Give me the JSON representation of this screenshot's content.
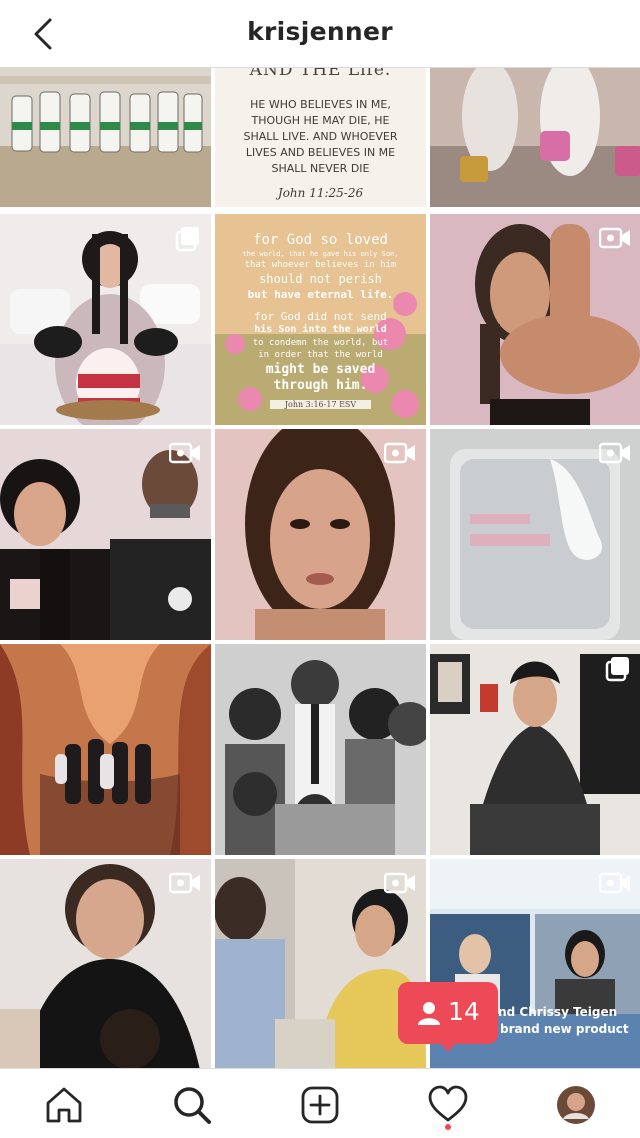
{
  "header": {
    "title": "krisjenner",
    "back_icon": "chevron-left-icon"
  },
  "posts": [
    {
      "id": 1,
      "type": "photo",
      "overlay": "none",
      "colors": [
        "#ddd6cc",
        "#6f6a63"
      ]
    },
    {
      "id": 2,
      "type": "text-graphic",
      "overlay": "none",
      "lines": [
        "AND THE Life.",
        "HE WHO BELIEVES IN ME,",
        "THOUGH HE MAY DIE, HE",
        "SHALL LIVE. AND WHOEVER",
        "LIVES AND BELIEVES IN ME",
        "SHALL NEVER DIE",
        "John 11:25-26"
      ]
    },
    {
      "id": 3,
      "type": "photo",
      "overlay": "none",
      "colors": [
        "#c9b7ae",
        "#7e6e69"
      ]
    },
    {
      "id": 4,
      "type": "photo",
      "overlay": "carousel-icon",
      "colors": [
        "#f0ecec",
        "#cbb8bd"
      ]
    },
    {
      "id": 5,
      "type": "text-graphic",
      "overlay": "none",
      "lines": [
        "for God so loved",
        "the world, that he gave his only Son,",
        "that whoever believes in him",
        "should not perish",
        "but have eternal life.",
        "for God did not send",
        "his Son into the world",
        "to condemn the world, but",
        "in order that the world",
        "might be saved",
        "through him.",
        "John 3:16-17 ESV"
      ]
    },
    {
      "id": 6,
      "type": "video",
      "overlay": "video-icon",
      "colors": [
        "#d9b8c2",
        "#8d6a73"
      ]
    },
    {
      "id": 7,
      "type": "video",
      "overlay": "video-icon",
      "colors": [
        "#e6d8d8",
        "#2a2424"
      ]
    },
    {
      "id": 8,
      "type": "video",
      "overlay": "video-icon",
      "colors": [
        "#e3c4c0",
        "#6e4838"
      ]
    },
    {
      "id": 9,
      "type": "video",
      "overlay": "video-icon",
      "colors": [
        "#cfd1d1",
        "#9ea3a5"
      ]
    },
    {
      "id": 10,
      "type": "photo",
      "overlay": "none",
      "colors": [
        "#c4774a",
        "#5d2c21"
      ]
    },
    {
      "id": 11,
      "type": "photo",
      "overlay": "none",
      "colors": [
        "#cfcfcf",
        "#3b3b3b"
      ]
    },
    {
      "id": 12,
      "type": "photo",
      "overlay": "carousel-icon",
      "colors": [
        "#e9e6e2",
        "#2e2e2e"
      ]
    },
    {
      "id": 13,
      "type": "video",
      "overlay": "video-icon",
      "colors": [
        "#e7e2df",
        "#1c1c1c"
      ]
    },
    {
      "id": 14,
      "type": "video",
      "overlay": "video-icon",
      "colors": [
        "#e2dcd4",
        "#e6c85a"
      ]
    },
    {
      "id": 15,
      "type": "video",
      "overlay": "video-icon",
      "colors": [
        "#dfe8f0",
        "#4f6f92"
      ],
      "caption_lines": [
        "and Chrissy Teigen",
        "brand new product"
      ]
    }
  ],
  "activity": {
    "icon": "person-icon",
    "count": "14",
    "color": "#ed4956"
  },
  "bottom_nav": {
    "items": [
      {
        "name": "home",
        "icon": "home-icon"
      },
      {
        "name": "search",
        "icon": "search-icon"
      },
      {
        "name": "new-post",
        "icon": "plus-square-icon"
      },
      {
        "name": "activity",
        "icon": "heart-icon"
      },
      {
        "name": "profile",
        "icon": "avatar"
      }
    ],
    "notification_dot_color": "#ed4956"
  }
}
